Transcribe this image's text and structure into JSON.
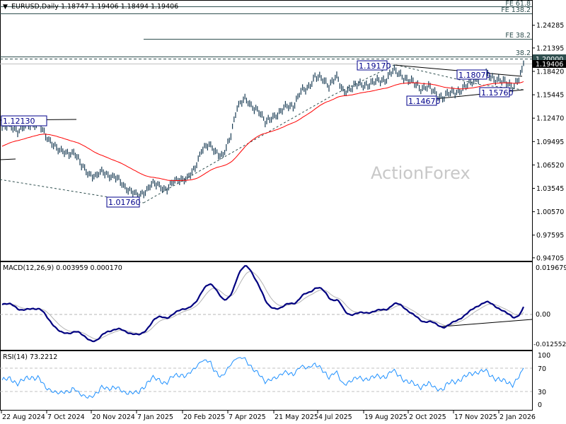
{
  "header": {
    "symbol": "EURUSD,Daily",
    "open": "1.18747",
    "high": "1.19406",
    "low": "1.18494",
    "close": "1.19406"
  },
  "price_axis": {
    "ticks": [
      "1.24285",
      "1.21395",
      "1.18420",
      "1.15445",
      "1.12470",
      "1.09495",
      "1.06520",
      "1.03545",
      "1.00570",
      "0.97595",
      "0.94705"
    ],
    "level_label": "1.20000",
    "current_label": "1.19406"
  },
  "fib_labels": {
    "fe618": "FE 61.8",
    "fe1382": "FE 138.2",
    "fe382": "FE 38.2",
    "r382": "38.2"
  },
  "annotations": {
    "a1": "1.12130",
    "a2": "1.01760",
    "a3": "1.19170",
    "a4": "1.18070",
    "a5": "1.14670",
    "a6": "1.15760"
  },
  "watermark": "ActionForex",
  "macd": {
    "title": "MACD(12,26,9) 0.003959 0.000170",
    "ticks": [
      "0.019679",
      "0.00",
      "-0.012552"
    ]
  },
  "rsi": {
    "title": "RSI(14) 73.2212",
    "ticks": [
      "100",
      "70",
      "30",
      "0"
    ]
  },
  "dates": [
    "22 Aug 2024",
    "7 Oct 2024",
    "20 Nov 2024",
    "7 Jan 2025",
    "20 Feb 2025",
    "7 Apr 2025",
    "21 May 2025",
    "4 Jul 2025",
    "19 Aug 2025",
    "2 Oct 2025",
    "17 Nov 2025",
    "2 Jan 2026"
  ],
  "colors": {
    "bar": "#1a3d55",
    "ma": "#ff0000",
    "macd": "#000080",
    "signal": "#b4b4b4",
    "rsi": "#1e90ff",
    "fib": "#2f4f4f"
  },
  "chart_data": {
    "type": "line",
    "title": "EURUSD,Daily",
    "description_of_sampling": "approximate closes sampled every ~3 trading days, 22 Aug 2024 to Jan 2026",
    "closes": [
      1.113,
      1.115,
      1.109,
      1.113,
      1.117,
      1.118,
      1.1,
      1.093,
      1.082,
      1.08,
      1.082,
      1.064,
      1.055,
      1.05,
      1.057,
      1.052,
      1.048,
      1.039,
      1.032,
      1.025,
      1.032,
      1.041,
      1.039,
      1.034,
      1.043,
      1.048,
      1.048,
      1.059,
      1.086,
      1.09,
      1.082,
      1.077,
      1.097,
      1.14,
      1.149,
      1.14,
      1.136,
      1.118,
      1.127,
      1.131,
      1.14,
      1.141,
      1.158,
      1.163,
      1.178,
      1.174,
      1.167,
      1.178,
      1.158,
      1.163,
      1.167,
      1.167,
      1.169,
      1.172,
      1.174,
      1.185,
      1.181,
      1.174,
      1.169,
      1.163,
      1.165,
      1.156,
      1.151,
      1.156,
      1.158,
      1.163,
      1.169,
      1.176,
      1.181,
      1.176,
      1.174,
      1.169,
      1.165,
      1.178,
      1.19406
    ],
    "ylim": [
      0.94705,
      1.24285
    ],
    "levels": {
      "fe_61_8": 1.2729,
      "fe_138_2": 1.264,
      "fe_38_2": 1.222,
      "ret_38_2": 1.2008,
      "round": 1.2
    },
    "macd_ylim": [
      -0.012552,
      0.019679
    ],
    "rsi_ylim": [
      0,
      100
    ]
  }
}
